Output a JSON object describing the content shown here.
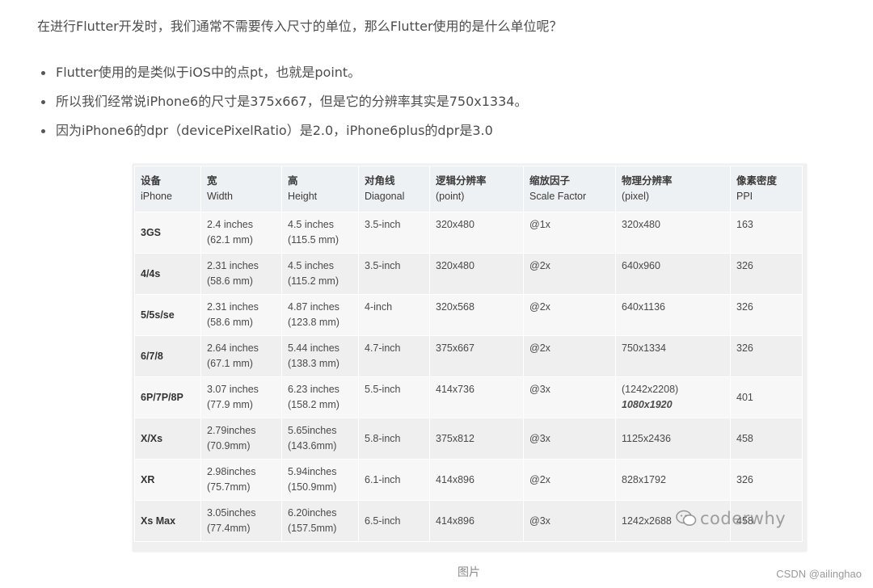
{
  "intro": "在进行Flutter开发时，我们通常不需要传入尺寸的单位，那么Flutter使用的是什么单位呢？",
  "bullets": [
    "Flutter使用的是类似于iOS中的点pt，也就是point。",
    "所以我们经常说iPhone6的尺寸是375x667，但是它的分辨率其实是750x1334。",
    "因为iPhone6的dpr（devicePixelRatio）是2.0，iPhone6plus的dpr是3.0"
  ],
  "table": {
    "headers": [
      {
        "cn": "设备",
        "en": "iPhone"
      },
      {
        "cn": "宽",
        "en": "Width"
      },
      {
        "cn": "高",
        "en": "Height"
      },
      {
        "cn": "对角线",
        "en": "Diagonal"
      },
      {
        "cn": "逻辑分辨率",
        "en": "(point)"
      },
      {
        "cn": "缩放因子",
        "en": "Scale Factor"
      },
      {
        "cn": "物理分辨率",
        "en": "(pixel)"
      },
      {
        "cn": "像素密度",
        "en": "PPI"
      }
    ],
    "rows": [
      {
        "device": "3GS",
        "width": [
          "2.4 inches",
          "(62.1 mm)"
        ],
        "height": [
          "4.5 inches",
          "(115.5 mm)"
        ],
        "diagonal": "3.5-inch",
        "logical": "320x480",
        "scale": "@1x",
        "physical": [
          "320x480",
          ""
        ],
        "ppi": "163"
      },
      {
        "device": "4/4s",
        "width": [
          "2.31 inches",
          "(58.6 mm)"
        ],
        "height": [
          "4.5 inches",
          "(115.2 mm)"
        ],
        "diagonal": "3.5-inch",
        "logical": "320x480",
        "scale": "@2x",
        "physical": [
          "640x960",
          ""
        ],
        "ppi": "326"
      },
      {
        "device": "5/5s/se",
        "width": [
          "2.31 inches",
          "(58.6 mm)"
        ],
        "height": [
          "4.87 inches",
          "(123.8 mm)"
        ],
        "diagonal": "4-inch",
        "logical": "320x568",
        "scale": "@2x",
        "physical": [
          "640x1136",
          ""
        ],
        "ppi": "326"
      },
      {
        "device": "6/7/8",
        "width": [
          "2.64 inches",
          "(67.1 mm)"
        ],
        "height": [
          "5.44 inches",
          "(138.3 mm)"
        ],
        "diagonal": "4.7-inch",
        "logical": "375x667",
        "scale": "@2x",
        "physical": [
          "750x1334",
          ""
        ],
        "ppi": "326"
      },
      {
        "device": "6P/7P/8P",
        "width": [
          "3.07 inches",
          "(77.9 mm)"
        ],
        "height": [
          "6.23 inches",
          "(158.2 mm)"
        ],
        "diagonal": "5.5-inch",
        "logical": "414x736",
        "scale": "@3x",
        "physical": [
          "(1242x2208)",
          "1080x1920"
        ],
        "ppi": "401"
      },
      {
        "device": "X/Xs",
        "width": [
          "2.79inches",
          "(70.9mm)"
        ],
        "height": [
          "5.65inches",
          "(143.6mm)"
        ],
        "diagonal": "5.8-inch",
        "logical": "375x812",
        "scale": "@3x",
        "physical": [
          "1125x2436",
          ""
        ],
        "ppi": "458"
      },
      {
        "device": "XR",
        "width": [
          "2.98inches",
          "(75.7mm)"
        ],
        "height": [
          "5.94inches",
          "(150.9mm)"
        ],
        "diagonal": "6.1-inch",
        "logical": "414x896",
        "scale": "@2x",
        "physical": [
          "828x1792",
          ""
        ],
        "ppi": "326"
      },
      {
        "device": "Xs Max",
        "width": [
          "3.05inches",
          "(77.4mm)"
        ],
        "height": [
          "6.20inches",
          "(157.5mm)"
        ],
        "diagonal": "6.5-inch",
        "logical": "414x896",
        "scale": "@3x",
        "physical": [
          "1242x2688",
          ""
        ],
        "ppi": "458"
      }
    ]
  },
  "watermark": "coderwhy",
  "caption": "图片",
  "credit": "CSDN @ailinghao"
}
